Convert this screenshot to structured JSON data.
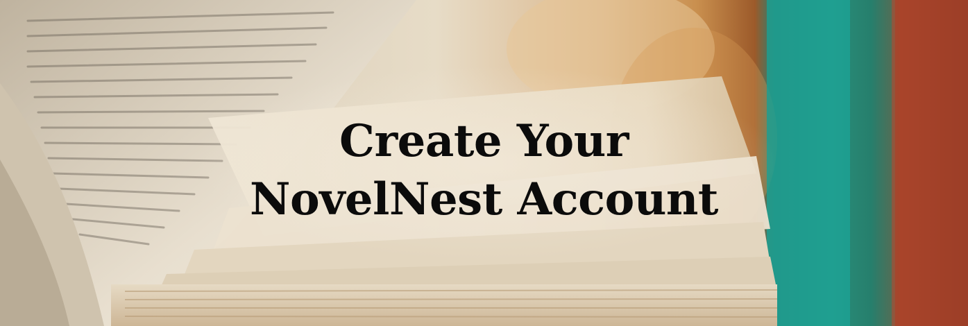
{
  "hero": {
    "title_line1": "Create Your",
    "title_line2": "NovelNest Account",
    "image": "open-book-photo"
  },
  "colors": {
    "text": "#0b0b0b",
    "paper_light": "#ece3d2",
    "paper_shadow": "#b9a88e",
    "warm_bokeh": "#c98b45",
    "teal_spine": "#1f9b8c",
    "red_spine": "#a9432a"
  }
}
